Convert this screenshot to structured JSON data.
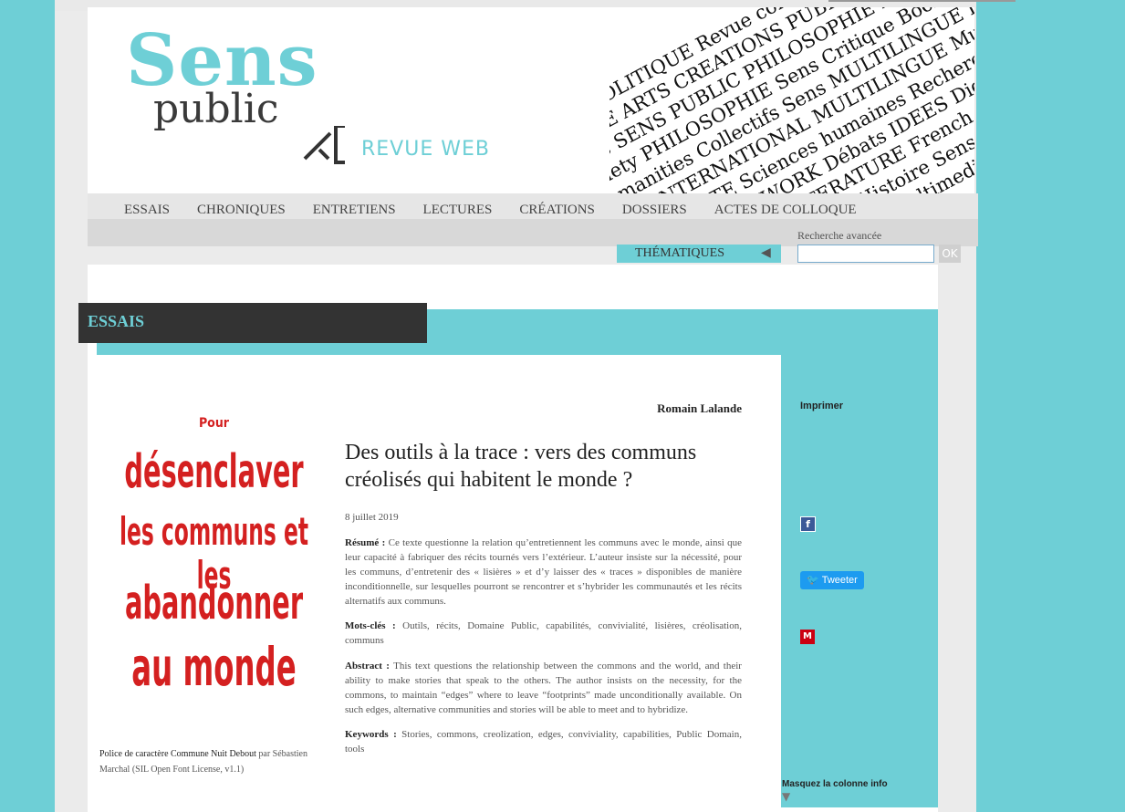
{
  "logo": {
    "sens": "Sens",
    "public": "public",
    "revue": "REVUE WEB"
  },
  "wordcloud": [
    "PUBLIC POLITIQUE Revue contemporaine",
    "SOCIETE ARTS CREATIONS PUBLIC Contributions",
    "Poésie SENS PUBLIC PHILOSOPHIE French theory Books Circulation",
    "Society PHILOSOPHIE Sens Critique Books Collectifs Histoire",
    "Humanities Collectifs Sens MULTILINGUE History Réseau International",
    "Web INTERNATIONAL MULTILINGUE Multimedia Digital Numérique PUBLIC",
    "ACTUALITE Sciences humaines Recherche Sens ARTS Collectifs",
    "SOCIAL NETWORK Débats IDEES Digital Poetry Culture Humanities",
    "RESEARCH LITTERATURE French theory ACTUALITE Web",
    "CREATIONS Books Histoire Sens Critique",
    "SENS PUBLIC ARTS Multimedia"
  ],
  "nav": {
    "items": [
      "ESSAIS",
      "CHRONIQUES",
      "ENTRETIENS",
      "LECTURES",
      "CRÉATIONS",
      "DOSSIERS",
      "ACTES DE COLLOQUE"
    ]
  },
  "toolbar": {
    "thematiques": "THÉMATIQUES",
    "recherche": "Recherche avancée",
    "ok": "OK"
  },
  "section": {
    "title": "ESSAIS"
  },
  "cover": {
    "pour": "Pour",
    "lines": [
      "désenclaver",
      "les communs et les",
      "abandonner",
      "au monde"
    ]
  },
  "caption": {
    "font": "Police de caractère Commune Nuit Debout",
    "rest": " par Sébastien Marchal (SIL Open Font License, v1.1)"
  },
  "article": {
    "author": "Romain Lalande",
    "title": "Des outils à la trace : vers des communs créolisés qui habitent le monde ?",
    "date": "8 juillet 2019",
    "resume_label": "Résumé :",
    "resume": "Ce texte questionne la relation qu’entretiennent les communs avec le monde, ainsi que leur capacité à fabriquer des récits tournés vers l’extérieur. L’auteur insiste sur la nécessité, pour les communs, d’entretenir des « lisières » et d’y laisser des « traces » disponibles de manière inconditionnelle, sur lesquelles pourront se rencontrer et s’hybrider les communautés et les récits alternatifs aux communs.",
    "motscles_label": "Mots-clés :",
    "motscles": "Outils, récits, Domaine Public, capabilités, convivialité, lisières, créolisation, communs",
    "abstract_label": "Abstract :",
    "abstract": "This text questions the relationship between the commons and the world, and their ability to make stories that speak to the others. The author insists on the necessity, for the commons, to maintain “edges” where to leave “footprints” made unconditionally available. On such edges, alternative communities and stories will be able to meet and to hybridize.",
    "keywords_label": "Keywords :",
    "keywords": "Stories, commons, creolization, edges, conviviality, capabilities, Public Domain, tools"
  },
  "sidebar": {
    "imprimer": "Imprimer",
    "tweeter": "Tweeter",
    "masquer": "Masquez la colonne info",
    "fb_letter": "f",
    "mendeley_letter": "M"
  }
}
